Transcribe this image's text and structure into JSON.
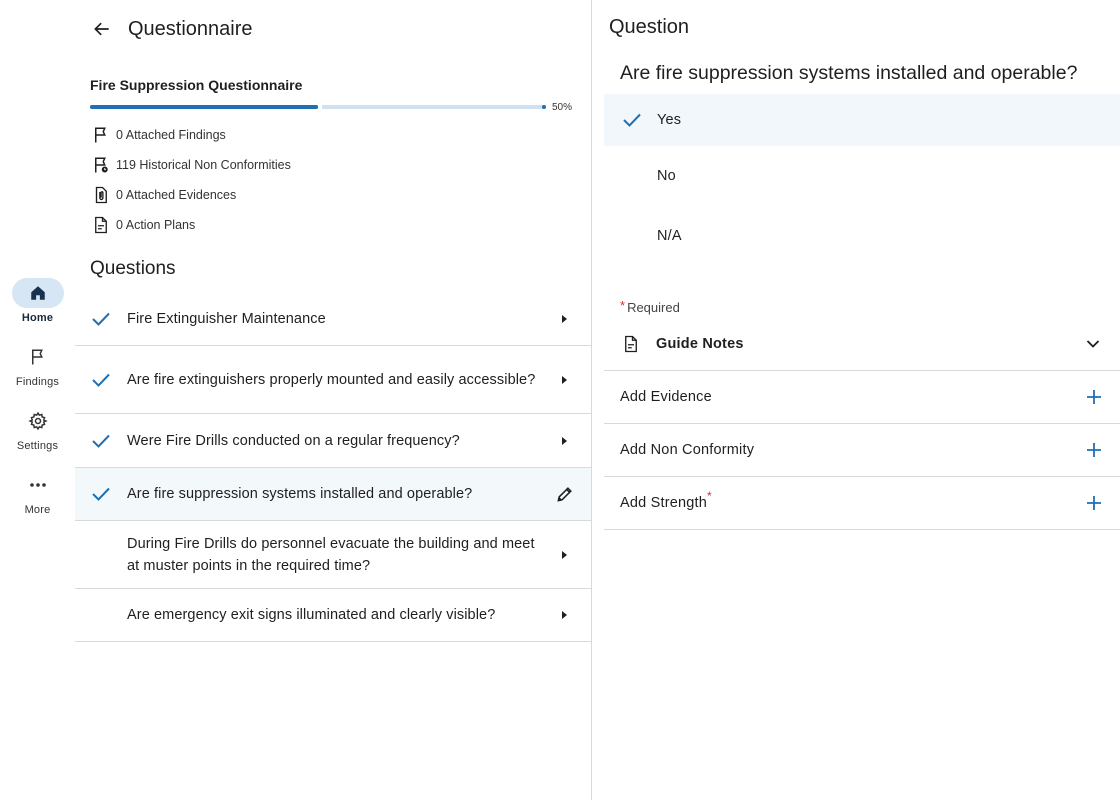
{
  "nav": {
    "items": [
      {
        "label": "Home",
        "icon": "home-icon",
        "active": true
      },
      {
        "label": "Findings",
        "icon": "flag-icon",
        "active": false
      },
      {
        "label": "Settings",
        "icon": "gear-icon",
        "active": false
      },
      {
        "label": "More",
        "icon": "more-icon",
        "active": false
      }
    ]
  },
  "header": {
    "title": "Questionnaire",
    "back_icon": "arrow-left-icon"
  },
  "questionnaire": {
    "name": "Fire Suppression Questionnaire",
    "progress": 0.5,
    "progress_label": "50%",
    "stats": [
      {
        "icon": "flag-icon",
        "text": "0 Attached Findings"
      },
      {
        "icon": "flag-clock-icon",
        "text": "119 Historical Non Conformities"
      },
      {
        "icon": "paperclip-doc-icon",
        "text": "0 Attached Evidences"
      },
      {
        "icon": "document-icon",
        "text": "0 Action Plans"
      }
    ]
  },
  "questions": {
    "heading": "Questions",
    "items": [
      {
        "text": "Fire Extinguisher Maintenance",
        "answered": true,
        "selected": false
      },
      {
        "text": "Are fire extinguishers properly mounted and easily accessible?",
        "answered": true,
        "selected": false
      },
      {
        "text": "Were Fire Drills conducted on a regular frequency?",
        "answered": true,
        "selected": false
      },
      {
        "text": "Are fire suppression systems installed and operable?",
        "answered": true,
        "selected": true
      },
      {
        "text": "During Fire Drills do personnel evacuate the building and meet at muster points in the required time?",
        "answered": false,
        "selected": false
      },
      {
        "text": "Are emergency exit signs illuminated and clearly visible?",
        "answered": false,
        "selected": false
      }
    ]
  },
  "detail": {
    "title": "Question",
    "question": "Are fire suppression systems installed and operable?",
    "answers": [
      {
        "label": "Yes",
        "selected": true
      },
      {
        "label": "No",
        "selected": false
      },
      {
        "label": "N/A",
        "selected": false
      }
    ],
    "required_label": "Required",
    "guide_notes": "Guide Notes",
    "add_evidence": "Add Evidence",
    "add_non_conformity": "Add Non Conformity",
    "add_strength": "Add Strength"
  },
  "colors": {
    "accent": "#1f6fb5",
    "required": "#d32f2f",
    "selected_bg": "#f3f8fb",
    "nav_active_bg": "#d6e6f5"
  }
}
